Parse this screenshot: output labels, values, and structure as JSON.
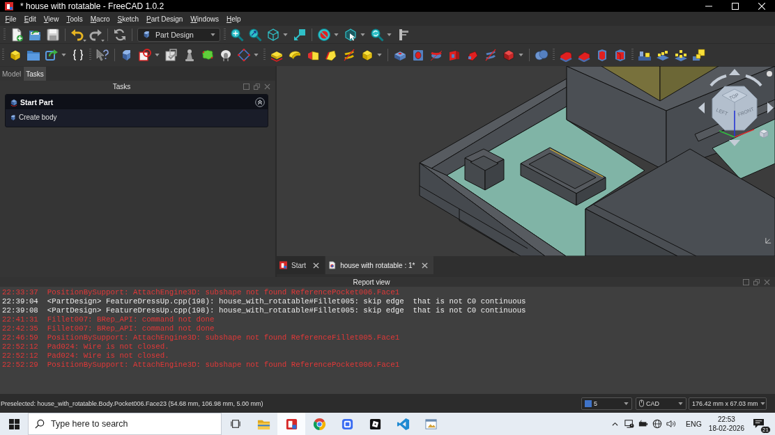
{
  "window": {
    "title": "* house with rotatable - FreeCAD 1.0.2"
  },
  "menu": [
    "File",
    "Edit",
    "View",
    "Tools",
    "Macro",
    "Sketch",
    "Part Design",
    "Windows",
    "Help"
  ],
  "toolbar": {
    "workbench": "Part Design"
  },
  "panel_tabs": [
    {
      "label": "Model",
      "selected": false
    },
    {
      "label": "Tasks",
      "selected": true
    }
  ],
  "tasks_panel": {
    "title": "Tasks",
    "task_box": {
      "title": "Start Part",
      "expanded": true,
      "actions": [
        "Create body"
      ]
    }
  },
  "view_3d": {
    "nav_cube_labels": [
      "TOP",
      "LEFT",
      "FRONT"
    ]
  },
  "document_tabs": [
    {
      "label": "Start",
      "selected": false
    },
    {
      "label": "house with rotatable : 1*",
      "selected": true
    }
  ],
  "report_view": {
    "title": "Report view",
    "lines": [
      {
        "time": "22:33:37",
        "kind": "error",
        "message": "PositionBySupport: AttachEngine3D: subshape not found ReferencePocket006.Face1"
      },
      {
        "time": "22:39:04",
        "kind": "log",
        "message": "<PartDesign> FeatureDressUp.cpp(198): house_with_rotatable#Fillet005: skip edge  that is not C0 continuous"
      },
      {
        "time": "22:39:08",
        "kind": "log",
        "message": "<PartDesign> FeatureDressUp.cpp(198): house_with_rotatable#Fillet005: skip edge  that is not C0 continuous"
      },
      {
        "time": "22:41:31",
        "kind": "error",
        "message": "Fillet007: BRep_API: command not done"
      },
      {
        "time": "22:42:35",
        "kind": "error",
        "message": "Fillet007: BRep_API: command not done"
      },
      {
        "time": "22:46:59",
        "kind": "error",
        "message": "PositionBySupport: AttachEngine3D: subshape not found ReferenceFillet005.Face1"
      },
      {
        "time": "22:52:12",
        "kind": "error",
        "message": "Pad024: Wire is not closed."
      },
      {
        "time": "22:52:12",
        "kind": "error",
        "message": "Pad024: Wire is not closed."
      },
      {
        "time": "22:52:29",
        "kind": "error",
        "message": "PositionBySupport: AttachEngine3D: subshape not found ReferencePocket006.Face1"
      }
    ]
  },
  "status_bar": {
    "message": "Preselected: house_with_rotatable.Body.Pocket006.Face23 (54.68 mm, 106.98 mm, 5.00 mm)",
    "counter": "5",
    "navigation_style": "CAD",
    "view_size": "176.42 mm x 67.03 mm"
  },
  "taskbar": {
    "search_placeholder": "Type here to search",
    "apps": [
      {
        "kind": "folder",
        "selected": false
      },
      {
        "kind": "blocks",
        "selected": true
      },
      {
        "kind": "circle",
        "selected": false
      },
      {
        "kind": "rounded-square",
        "selected": false
      },
      {
        "kind": "tilted-square",
        "selected": false
      },
      {
        "kind": "ribbon",
        "selected": false
      },
      {
        "kind": "window",
        "selected": false
      }
    ],
    "language": "ENG",
    "time": "22:53",
    "date": "18-02-2026",
    "notification_count": "21"
  }
}
